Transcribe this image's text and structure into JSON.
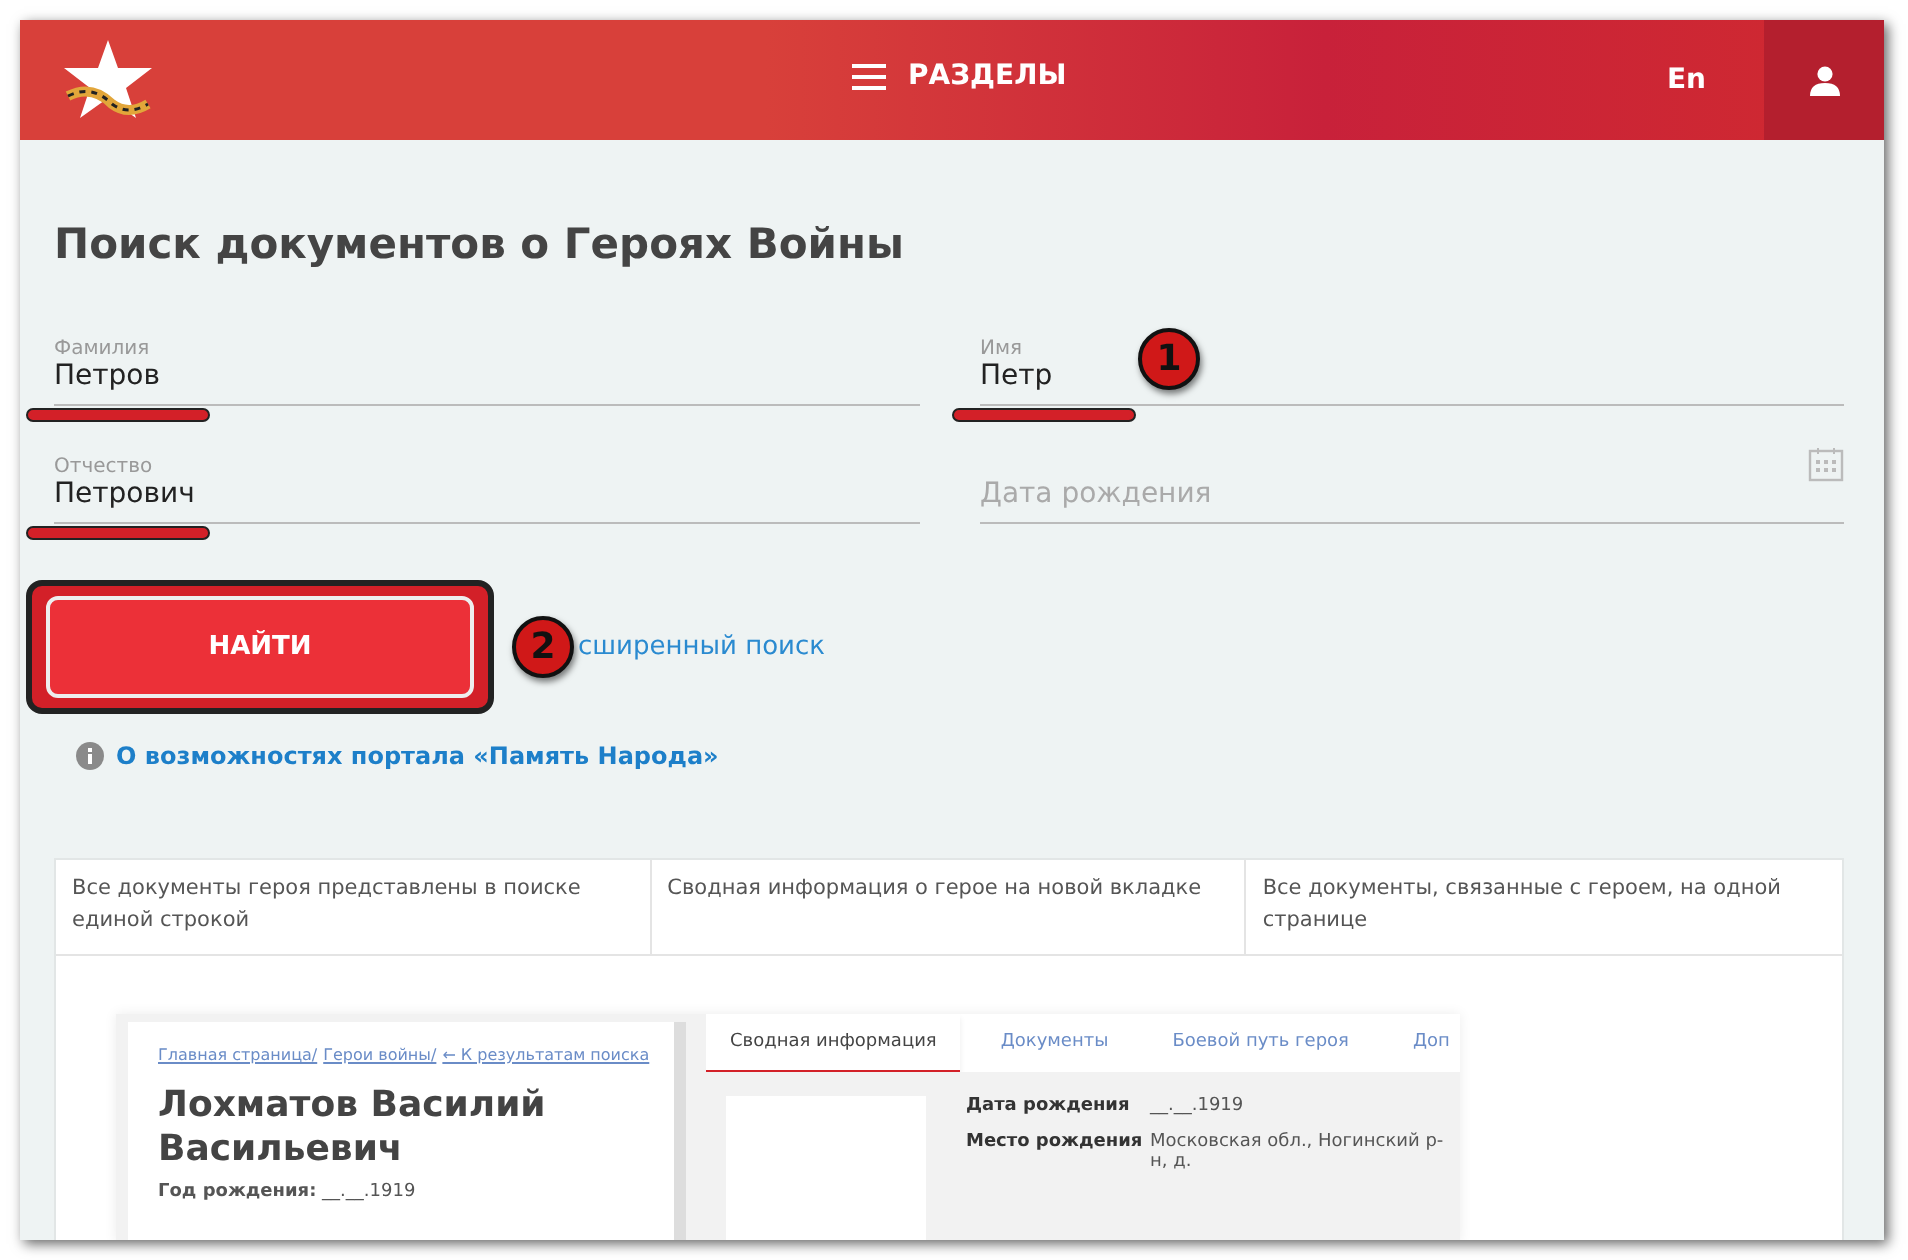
{
  "header": {
    "menu_label": "РАЗДЕЛЫ",
    "language": "En"
  },
  "title": "Поиск документов о Героях Войны",
  "fields": [
    {
      "kind": "text",
      "label": "Фамилия",
      "value": "Петров",
      "highlighted": true
    },
    {
      "kind": "text",
      "label": "Имя",
      "value": "Петр",
      "highlighted": true,
      "callout": "1"
    },
    {
      "kind": "text",
      "label": "Отчество",
      "value": "Петрович",
      "highlighted": true
    },
    {
      "kind": "date",
      "placeholder": "Дата рождения",
      "highlighted": false
    }
  ],
  "search_button": {
    "label": "НАЙТИ",
    "highlighted": true,
    "callout": "2"
  },
  "advanced_link": "сширенный поиск",
  "info_link": "О возможностях портала «Память Народа»",
  "features": [
    "Все документы героя представлены в поиске единой строкой",
    "Сводная информация о герое на новой вкладке",
    "Все документы, связанные с героем, на одной странице"
  ],
  "preview": {
    "breadcrumb": [
      "Главная страница/",
      "Герои войны/",
      "← К результатам поиска"
    ],
    "name": "Лохматов Василий Васильевич",
    "birth_label": "Год рождения:",
    "birth_value": "__.__.1919",
    "tabs": [
      {
        "label": "Сводная информация",
        "selected": true
      },
      {
        "label": "Документы",
        "selected": false
      },
      {
        "label": "Боевой путь героя",
        "selected": false
      },
      {
        "label": "Доп",
        "selected": false
      }
    ],
    "rows": [
      {
        "label": "Дата рождения",
        "value": "__.__.1919"
      },
      {
        "label": "Место рождения",
        "value": "Московская обл., Ногинский р-н, д."
      }
    ]
  }
}
